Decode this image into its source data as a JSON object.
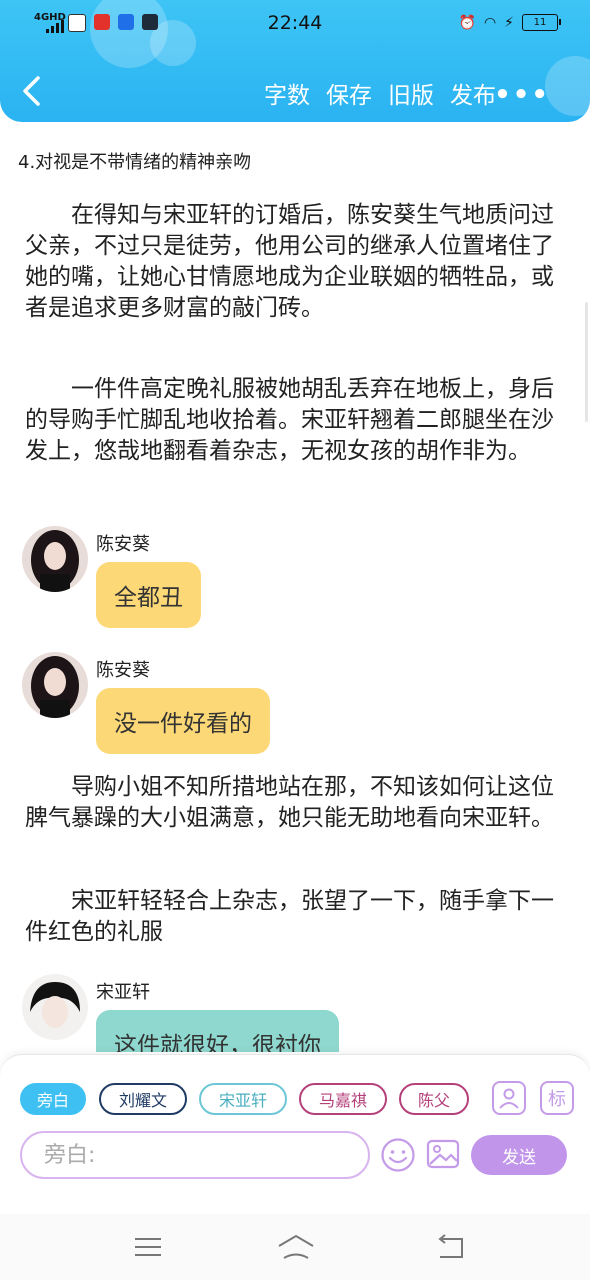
{
  "status_bar": {
    "network": "4GHD",
    "time": "22:44",
    "battery": "11"
  },
  "toolbar": {
    "word_count": "字数",
    "save": "保存",
    "old_version": "旧版",
    "publish": "发布",
    "more": "•••"
  },
  "chapter_title": "4.对视是不带情绪的精神亲吻",
  "paragraphs": [
    "在得知与宋亚轩的订婚后，陈安葵生气地质问过父亲，不过只是徒劳，他用公司的继承人位置堵住了她的嘴，让她心甘情愿地成为企业联姻的牺牲品，或者是追求更多财富的敲门砖。",
    "一件件高定晚礼服被她胡乱丢弃在地板上，身后的导购手忙脚乱地收拾着。宋亚轩翘着二郎腿坐在沙发上，悠哉地翻看着杂志，无视女孩的胡作非为。",
    "导购小姐不知所措地站在那，不知该如何让这位脾气暴躁的大小姐满意，她只能无助地看向宋亚轩。",
    "宋亚轩轻轻合上杂志，张望了一下，随手拿下一件红色的礼服"
  ],
  "dialogues": [
    {
      "speaker": "陈安葵",
      "text": "全都丑",
      "color": "#fdd877"
    },
    {
      "speaker": "陈安葵",
      "text": "没一件好看的",
      "color": "#fdd877"
    },
    {
      "speaker": "宋亚轩",
      "text": "这件就很好，很衬你",
      "color": "#8ed8cf"
    }
  ],
  "character_chips": [
    {
      "label": "旁白",
      "selected": true,
      "color": "#3ec0f2"
    },
    {
      "label": "刘耀文",
      "selected": false,
      "color": "#1f3a63"
    },
    {
      "label": "宋亚轩",
      "selected": false,
      "color": "#6cc6d6"
    },
    {
      "label": "马嘉祺",
      "selected": false,
      "color": "#b5407a"
    },
    {
      "label": "陈父",
      "selected": false,
      "color": "#b5407a"
    }
  ],
  "tag_button": "标",
  "input": {
    "placeholder": "旁白:"
  },
  "send_label": "发送",
  "colors": {
    "header": "#2ab3f2",
    "accent_purple": "#c195ea"
  }
}
